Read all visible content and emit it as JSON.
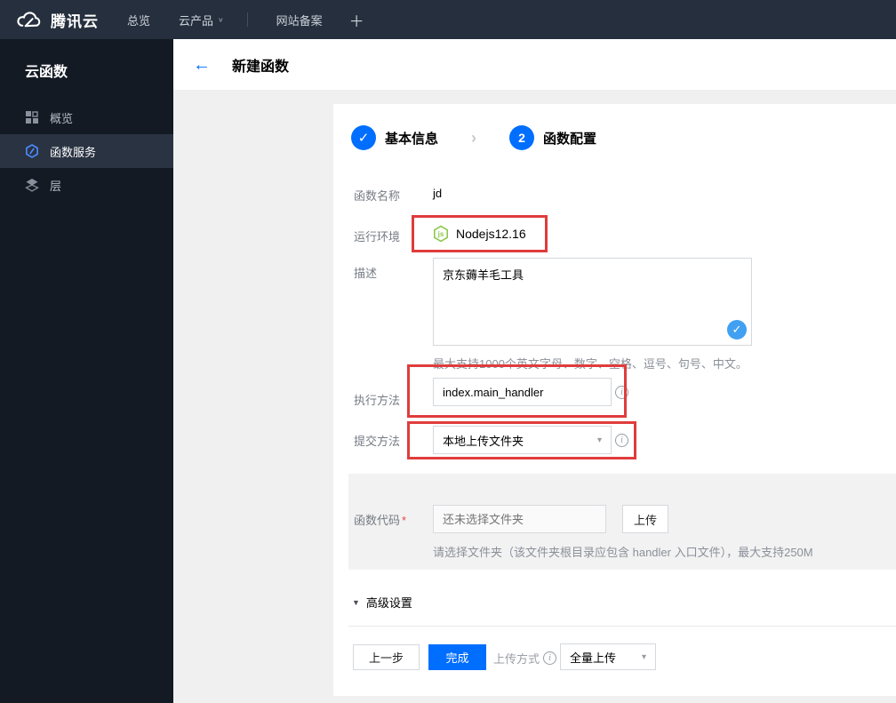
{
  "topnav": {
    "brand": "腾讯云",
    "items": [
      {
        "label": "总览"
      },
      {
        "label": "云产品"
      },
      {
        "label": "网站备案"
      }
    ],
    "plus": "＋"
  },
  "sidebar": {
    "title": "云函数",
    "items": [
      {
        "label": "概览"
      },
      {
        "label": "函数服务"
      },
      {
        "label": "层"
      }
    ]
  },
  "header": {
    "title": "新建函数"
  },
  "steps": [
    {
      "label": "基本信息"
    },
    {
      "num": "2",
      "label": "函数配置"
    }
  ],
  "form": {
    "function_name": {
      "label": "函数名称",
      "value": "jd"
    },
    "runtime": {
      "label": "运行环境",
      "value": "Nodejs12.16"
    },
    "description": {
      "label": "描述",
      "value": "京东薅羊毛工具",
      "helper": "最大支持1000个英文字母、数字、空格、逗号、句号、中文。"
    },
    "handler": {
      "label": "执行方法",
      "value": "index.main_handler"
    },
    "submit_method": {
      "label": "提交方法",
      "value": "本地上传文件夹"
    },
    "function_code": {
      "label": "函数代码",
      "required_mark": "*",
      "placeholder": "还未选择文件夹",
      "upload_button": "上传",
      "helper": "请选择文件夹（该文件夹根目录应包含 handler 入口文件），最大支持250M"
    },
    "advanced_label": "高级设置"
  },
  "footer": {
    "prev_button": "上一步",
    "finish_button": "完成",
    "upload_mode_label": "上传方式",
    "upload_mode_value": "全量上传"
  },
  "icons": {
    "back": "←",
    "check": "✓",
    "chevron": "›",
    "caret_down": "▾",
    "triangle_down": "▼",
    "nav_caret": "∨",
    "info": "i",
    "nodejs_text": "js"
  },
  "colors": {
    "nav_bg": "#252f3d",
    "sidebar_bg": "#141a24",
    "accent_blue": "#006eff",
    "check_blue": "#41a0f2",
    "annotation_red": "#e03c3c",
    "node_green": "#8cc84b"
  }
}
